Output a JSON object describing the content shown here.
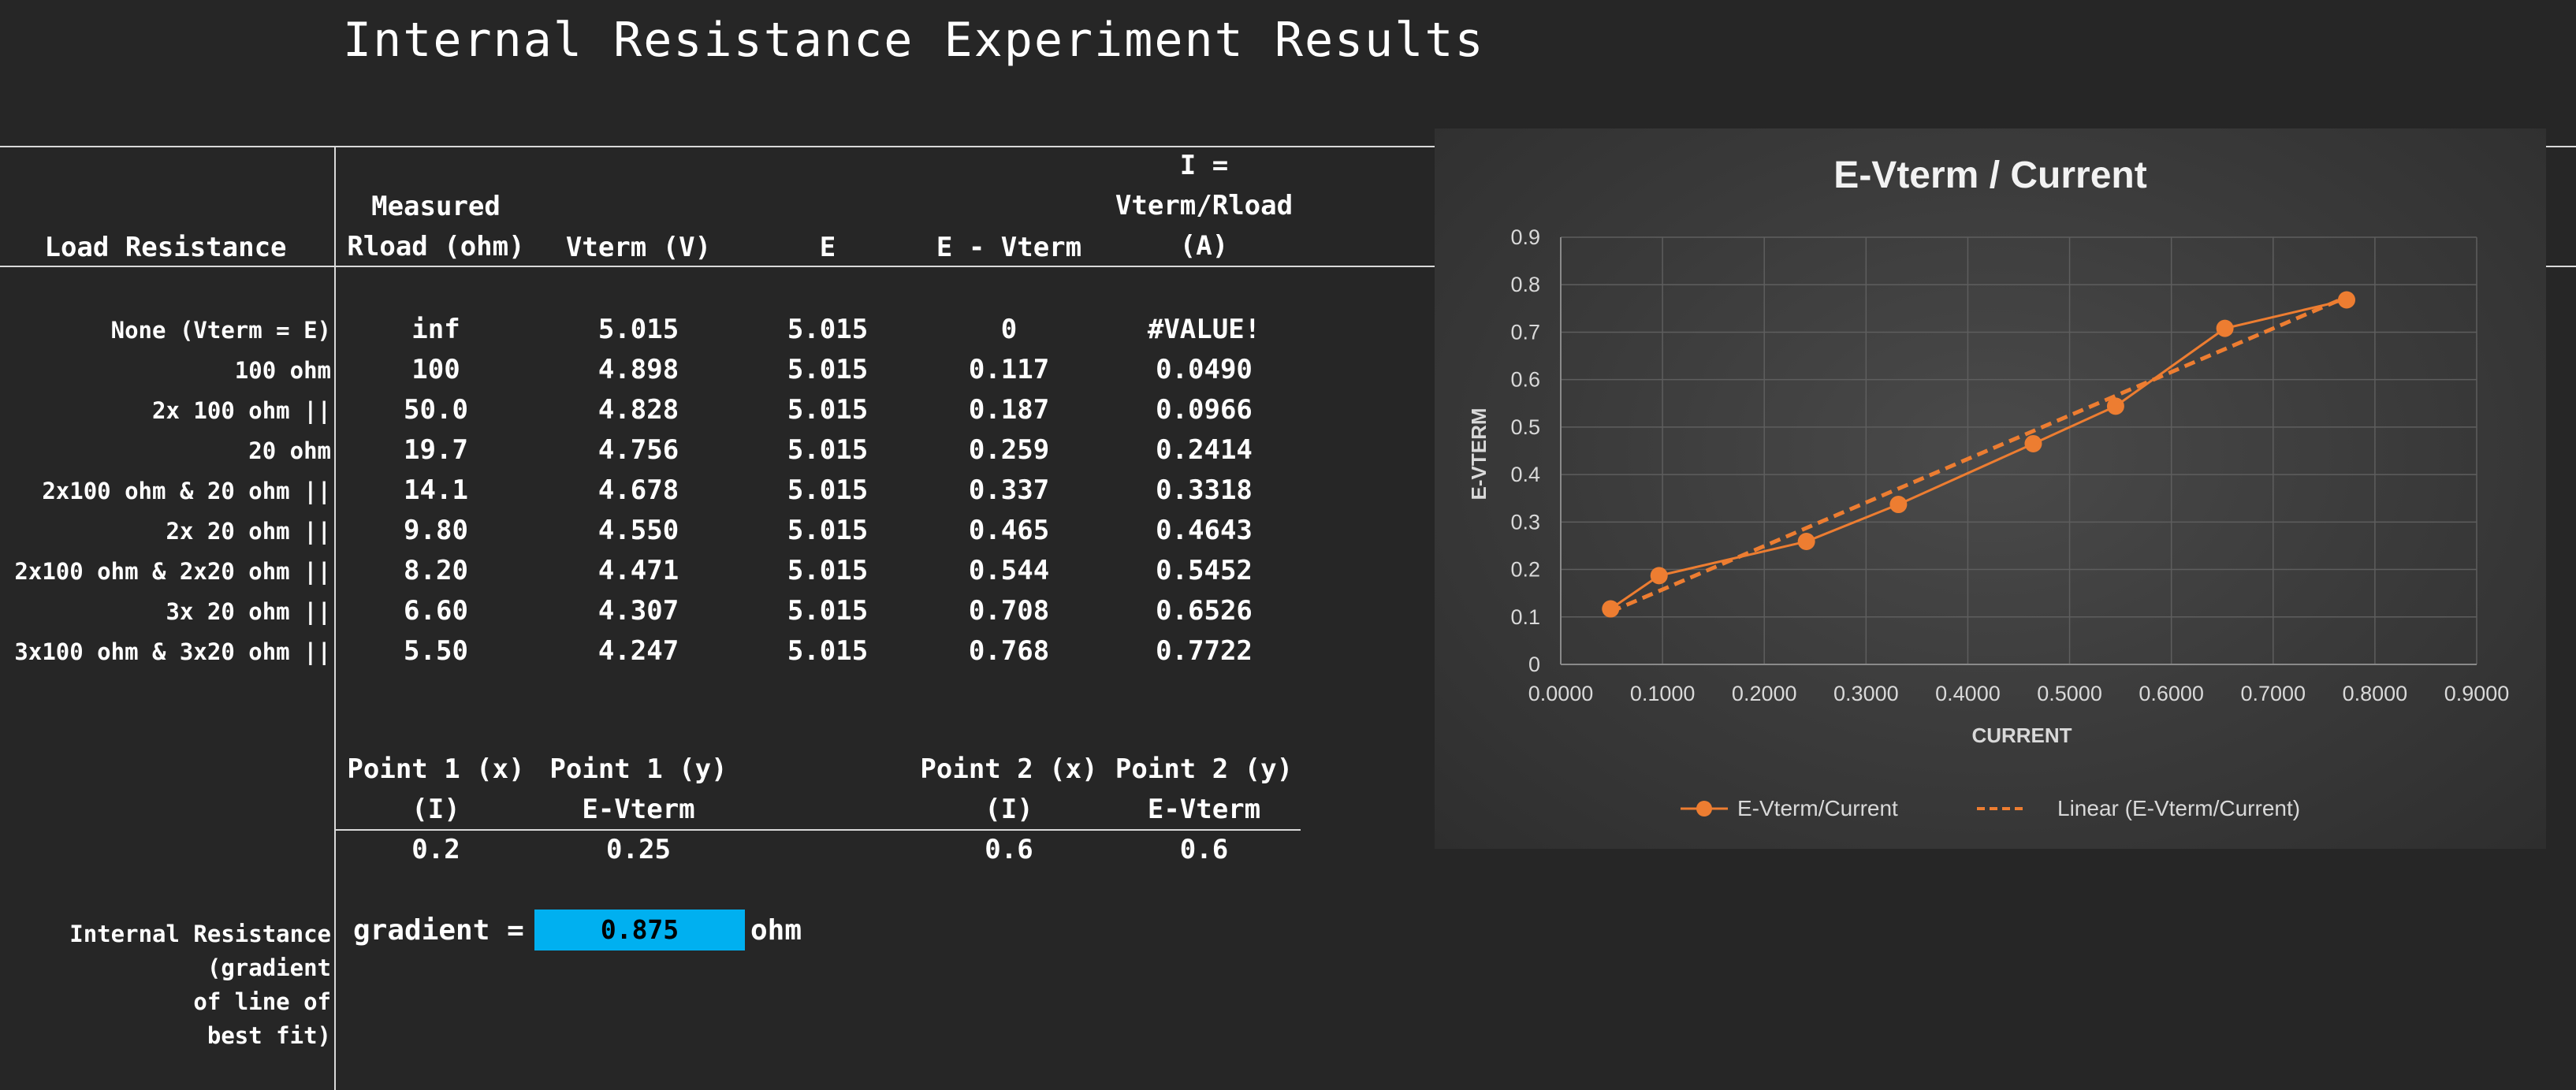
{
  "title": "Internal Resistance Experiment Results",
  "table": {
    "headers": {
      "load_resistance": "Load Resistance",
      "rload_line1": "Measured",
      "rload_line2": "Rload (ohm)",
      "vterm": "Vterm (V)",
      "e": "E",
      "e_minus_vterm": "E - Vterm",
      "current_line1": "I =",
      "current_line2": "Vterm/Rload",
      "current_line3": "(A)"
    },
    "rows": [
      {
        "label": "None (Vterm = E)",
        "rload": "inf",
        "vterm": "5.015",
        "e": "5.015",
        "e_minus_vterm": "0",
        "current": "#VALUE!"
      },
      {
        "label": "100 ohm",
        "rload": "100",
        "vterm": "4.898",
        "e": "5.015",
        "e_minus_vterm": "0.117",
        "current": "0.0490"
      },
      {
        "label": "2x 100 ohm ||",
        "rload": "50.0",
        "vterm": "4.828",
        "e": "5.015",
        "e_minus_vterm": "0.187",
        "current": "0.0966"
      },
      {
        "label": "20 ohm",
        "rload": "19.7",
        "vterm": "4.756",
        "e": "5.015",
        "e_minus_vterm": "0.259",
        "current": "0.2414"
      },
      {
        "label": "2x100 ohm & 20 ohm ||",
        "rload": "14.1",
        "vterm": "4.678",
        "e": "5.015",
        "e_minus_vterm": "0.337",
        "current": "0.3318"
      },
      {
        "label": "2x 20 ohm ||",
        "rload": "9.80",
        "vterm": "4.550",
        "e": "5.015",
        "e_minus_vterm": "0.465",
        "current": "0.4643"
      },
      {
        "label": "2x100 ohm & 2x20 ohm ||",
        "rload": "8.20",
        "vterm": "4.471",
        "e": "5.015",
        "e_minus_vterm": "0.544",
        "current": "0.5452"
      },
      {
        "label": "3x 20 ohm ||",
        "rload": "6.60",
        "vterm": "4.307",
        "e": "5.015",
        "e_minus_vterm": "0.708",
        "current": "0.6526"
      },
      {
        "label": "3x100 ohm & 3x20 ohm ||",
        "rload": "5.50",
        "vterm": "4.247",
        "e": "5.015",
        "e_minus_vterm": "0.768",
        "current": "0.7722"
      }
    ]
  },
  "points": {
    "p1x_line1": "Point 1 (x)",
    "p1x_line2": "(I)",
    "p1y_line1": "Point 1 (y)",
    "p1y_line2": "E-Vterm",
    "p2x_line1": "Point 2 (x)",
    "p2x_line2": "(I)",
    "p2y_line1": "Point 2 (y)",
    "p2y_line2": "E-Vterm",
    "p1x": "0.2",
    "p1y": "0.25",
    "p2x": "0.6",
    "p2y": "0.6"
  },
  "internal_resistance": {
    "label_line1": "Internal Resistance",
    "label_line2": "(gradient",
    "label_line3": "of line of",
    "label_line4": "best fit)",
    "gradient_label": "gradient =",
    "gradient_value": "0.875",
    "unit": "ohm"
  },
  "chart_data": {
    "type": "scatter",
    "title": "E-Vterm / Current",
    "xlabel": "CURRENT",
    "ylabel": "E-VTERM",
    "xlim": [
      0,
      0.9
    ],
    "ylim": [
      0,
      0.9
    ],
    "x_ticks": [
      "0.0000",
      "0.1000",
      "0.2000",
      "0.3000",
      "0.4000",
      "0.5000",
      "0.6000",
      "0.7000",
      "0.8000",
      "0.9000"
    ],
    "y_ticks": [
      "0",
      "0.1",
      "0.2",
      "0.3",
      "0.4",
      "0.5",
      "0.6",
      "0.7",
      "0.8",
      "0.9"
    ],
    "grid": true,
    "legend_position": "bottom",
    "series": [
      {
        "name": "E-Vterm/Current",
        "color": "#ed7d31",
        "x": [
          0.049,
          0.0966,
          0.2414,
          0.3318,
          0.4643,
          0.5452,
          0.6526,
          0.7722
        ],
        "y": [
          0.117,
          0.187,
          0.259,
          0.337,
          0.465,
          0.544,
          0.708,
          0.768
        ]
      }
    ],
    "trendline": {
      "name": "Linear (E-Vterm/Current)",
      "color": "#ed7d31",
      "style": "dashed",
      "x": [
        0.049,
        0.7722
      ],
      "y": [
        0.111,
        0.774
      ]
    }
  }
}
